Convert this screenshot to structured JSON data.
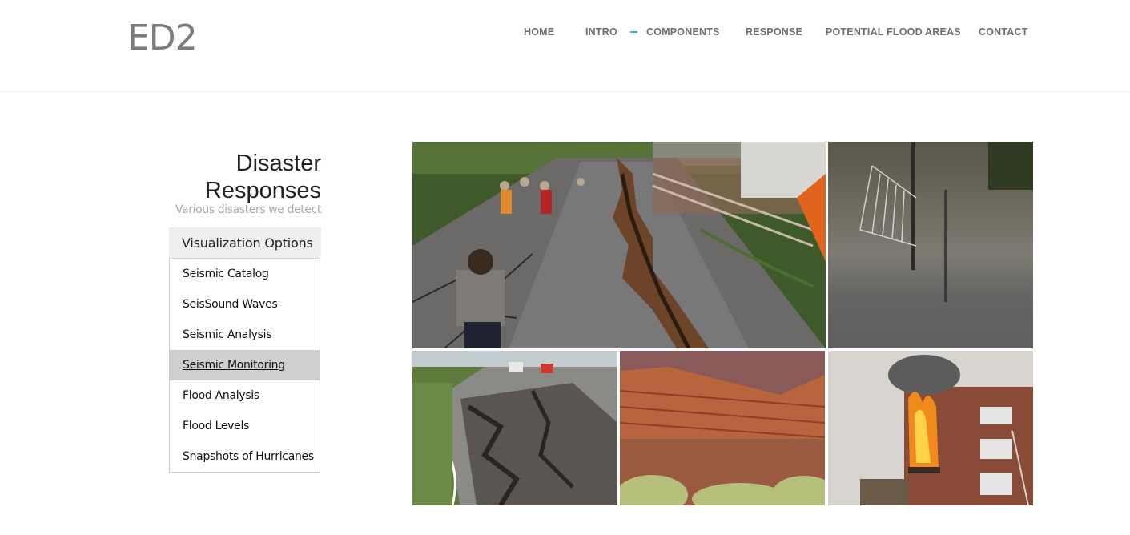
{
  "logo": "ED2",
  "nav": {
    "items": [
      {
        "label": "HOME"
      },
      {
        "label": "INTRO"
      },
      {
        "label": "COMPONENTS"
      },
      {
        "label": "RESPONSE"
      },
      {
        "label": "POTENTIAL FLOOD AREAS"
      },
      {
        "label": "CONTACT"
      }
    ],
    "accent_color": "#2bb6cf"
  },
  "sidebar": {
    "title_line1": "Disaster",
    "title_line2": "Responses",
    "subtitle": "Various disasters we detect",
    "options_heading": "Visualization Options",
    "options": [
      {
        "label": "Seismic Catalog"
      },
      {
        "label": "SeisSound Waves"
      },
      {
        "label": "Seismic Analysis"
      },
      {
        "label": "Seismic Monitoring",
        "active": true
      },
      {
        "label": "Flood Analysis"
      },
      {
        "label": "Flood Levels"
      },
      {
        "label": "Snapshots of Hurricanes"
      }
    ]
  },
  "gallery": {
    "images": [
      {
        "subject": "cracked-road-earthquake"
      },
      {
        "subject": "flooded-fence"
      },
      {
        "subject": "collapsed-road"
      },
      {
        "subject": "red-canyon-cliff"
      },
      {
        "subject": "burning-building"
      }
    ]
  }
}
